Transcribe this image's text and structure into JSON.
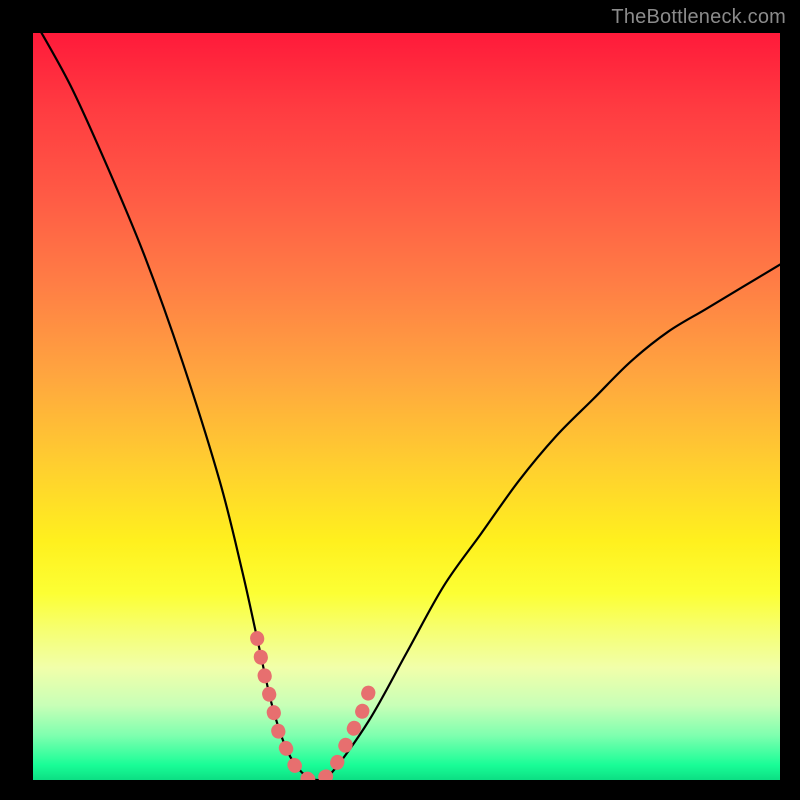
{
  "watermark": "TheBottleneck.com",
  "chart_data": {
    "type": "line",
    "title": "",
    "xlabel": "",
    "ylabel": "",
    "xlim": [
      0,
      100
    ],
    "ylim": [
      0,
      100
    ],
    "series": [
      {
        "name": "bottleneck-curve",
        "x": [
          0,
          5,
          10,
          15,
          20,
          25,
          28,
          30,
          32,
          34,
          36,
          38,
          40,
          45,
          50,
          55,
          60,
          65,
          70,
          75,
          80,
          85,
          90,
          95,
          100
        ],
        "values": [
          102,
          93,
          82,
          70,
          56,
          40,
          28,
          19,
          10,
          4,
          1,
          0,
          1,
          8,
          17,
          26,
          33,
          40,
          46,
          51,
          56,
          60,
          63,
          66,
          69
        ]
      }
    ],
    "highlight": {
      "name": "marker-range",
      "x": [
        30,
        31,
        32,
        33,
        34,
        35,
        36,
        37,
        38,
        40,
        41,
        42,
        43,
        44,
        45
      ],
      "values": [
        19,
        14,
        10,
        6,
        4,
        2,
        1,
        0,
        0,
        1,
        3,
        5,
        7,
        9,
        12
      ]
    },
    "gradient_stops": [
      {
        "pos": 0,
        "color": "#ff1a3a"
      },
      {
        "pos": 50,
        "color": "#ffcf2f"
      },
      {
        "pos": 75,
        "color": "#fcff34"
      },
      {
        "pos": 100,
        "color": "#0cde83"
      }
    ]
  }
}
